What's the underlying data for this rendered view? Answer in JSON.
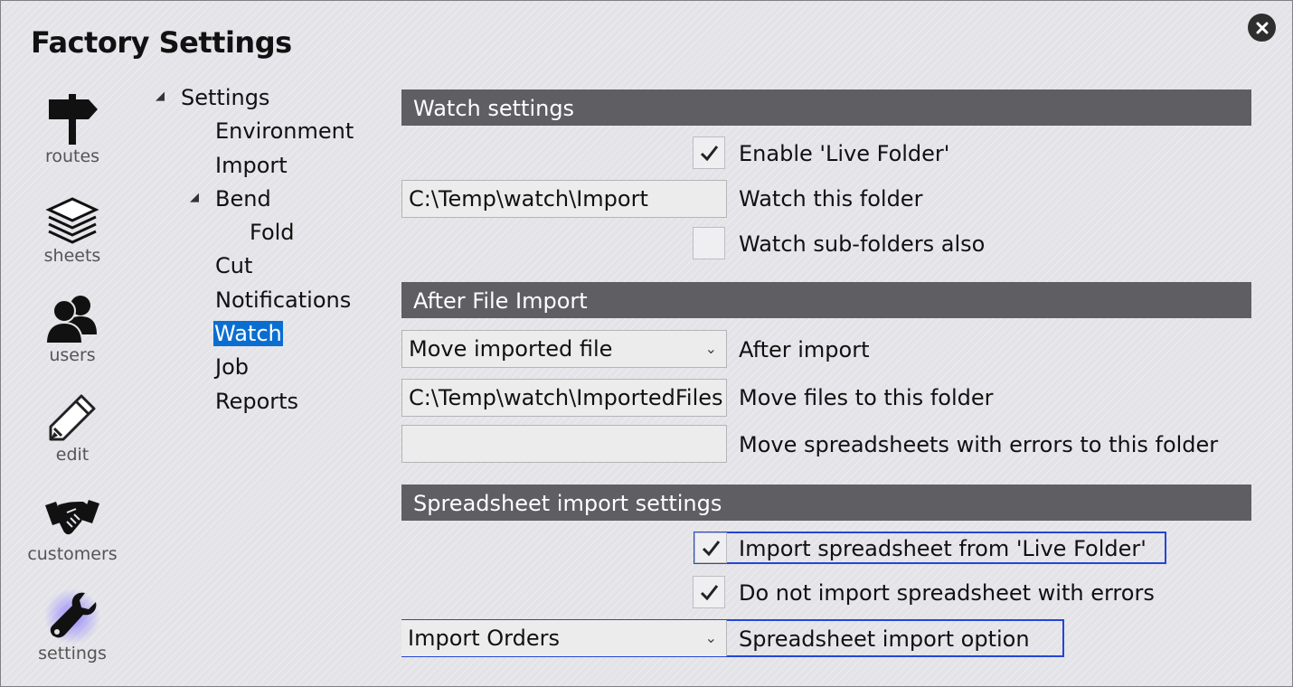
{
  "window": {
    "title": "Factory Settings"
  },
  "nav": [
    {
      "icon": "signpost-icon",
      "label": "routes"
    },
    {
      "icon": "sheets-stack-icon",
      "label": "sheets"
    },
    {
      "icon": "users-icon",
      "label": "users"
    },
    {
      "icon": "pencil-icon",
      "label": "edit"
    },
    {
      "icon": "handshake-icon",
      "label": "customers"
    },
    {
      "icon": "wrench-icon",
      "label": "settings",
      "active": true
    }
  ],
  "tree": {
    "root": "Settings",
    "items": [
      "Environment",
      "Import",
      "Bend",
      "Fold",
      "Cut",
      "Notifications",
      "Watch",
      "Job",
      "Reports"
    ],
    "selected": "Watch"
  },
  "watch": {
    "header": "Watch settings",
    "enable_live_folder": {
      "label": "Enable 'Live Folder'",
      "checked": true
    },
    "folder": {
      "value": "C:\\Temp\\watch\\Import",
      "label": "Watch this folder"
    },
    "subfolders": {
      "label": "Watch sub-folders also",
      "checked": false
    }
  },
  "after_import": {
    "header": "After File Import",
    "action": {
      "value": "Move imported file",
      "label": "After import"
    },
    "move_folder": {
      "value": "C:\\Temp\\watch\\ImportedFiles",
      "label": "Move files to this folder"
    },
    "error_folder": {
      "value": "",
      "label": "Move spreadsheets with errors to this folder"
    }
  },
  "spreadsheet": {
    "header": "Spreadsheet import settings",
    "import_from_live": {
      "label": "Import spreadsheet from 'Live Folder'",
      "checked": true
    },
    "skip_errors": {
      "label": "Do not import spreadsheet with errors",
      "checked": true
    },
    "option": {
      "value": "Import Orders",
      "label": "Spreadsheet import option"
    }
  },
  "colors": {
    "header_bg": "#5e5e63",
    "selection": "#0a6ed1",
    "highlight_border": "#2346d6",
    "active_glow": "#8a7cff"
  }
}
